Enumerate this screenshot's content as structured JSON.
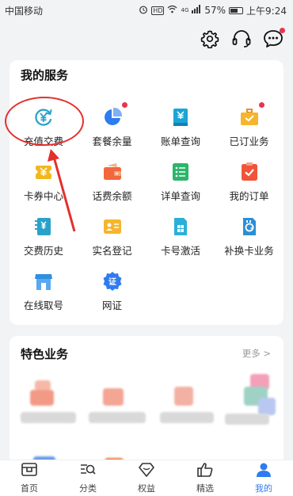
{
  "status_bar": {
    "carrier": "中国移动",
    "hd": "HD",
    "network": "4G",
    "battery": "57%",
    "battery_level": 0.57,
    "time": "上午9:24"
  },
  "top_actions": [
    {
      "name": "settings",
      "icon": "gear-icon"
    },
    {
      "name": "customer-service",
      "icon": "headset-icon"
    },
    {
      "name": "messages",
      "icon": "chat-bubble-icon",
      "badge": true
    }
  ],
  "services": {
    "title": "我的服务",
    "items": [
      {
        "label": "充值交费",
        "icon": "yuan-recharge-icon",
        "color": "#2aa2c8",
        "dot": false
      },
      {
        "label": "套餐余量",
        "icon": "pie-chart-icon",
        "color": "#2f7bf0",
        "dot": true
      },
      {
        "label": "账单查询",
        "icon": "bill-icon",
        "color": "#1aa5d6",
        "dot": false
      },
      {
        "label": "已订业务",
        "icon": "briefcase-icon",
        "color": "#f5b52d",
        "dot": true
      },
      {
        "label": "卡券中心",
        "icon": "coupon-icon",
        "color": "#f1b81e",
        "dot": false
      },
      {
        "label": "话费余额",
        "icon": "wallet-icon",
        "color": "#f0683c",
        "dot": false
      },
      {
        "label": "详单查询",
        "icon": "list-icon",
        "color": "#2cb66c",
        "dot": false
      },
      {
        "label": "我的订单",
        "icon": "order-check-icon",
        "color": "#f0553a",
        "dot": false
      },
      {
        "label": "交费历史",
        "icon": "history-icon",
        "color": "#2aa2c8",
        "dot": false
      },
      {
        "label": "实名登记",
        "icon": "id-card-icon",
        "color": "#f5b52d",
        "dot": false
      },
      {
        "label": "卡号激活",
        "icon": "sim-card-icon",
        "color": "#2ab0d8",
        "dot": false
      },
      {
        "label": "补换卡业务",
        "icon": "sim-swap-icon",
        "color": "#2a8fd8",
        "dot": false
      },
      {
        "label": "在线取号",
        "icon": "store-icon",
        "color": "#2f8fe0",
        "dot": false
      },
      {
        "label": "网证",
        "icon": "certificate-icon",
        "color": "#2f7bf0",
        "dot": false
      }
    ]
  },
  "features": {
    "title": "特色业务",
    "more": "更多 >"
  },
  "bottom_nav": [
    {
      "label": "首页",
      "icon": "home-icon",
      "active": false
    },
    {
      "label": "分类",
      "icon": "category-search-icon",
      "active": false
    },
    {
      "label": "权益",
      "icon": "diamond-icon",
      "active": false
    },
    {
      "label": "精选",
      "icon": "thumbs-up-icon",
      "active": false
    },
    {
      "label": "我的",
      "icon": "user-icon",
      "active": true
    }
  ],
  "colors": {
    "accent": "#2f7bf0",
    "annotation": "#e3302c",
    "badge": "#e8344e",
    "background": "#f2f3f5"
  }
}
